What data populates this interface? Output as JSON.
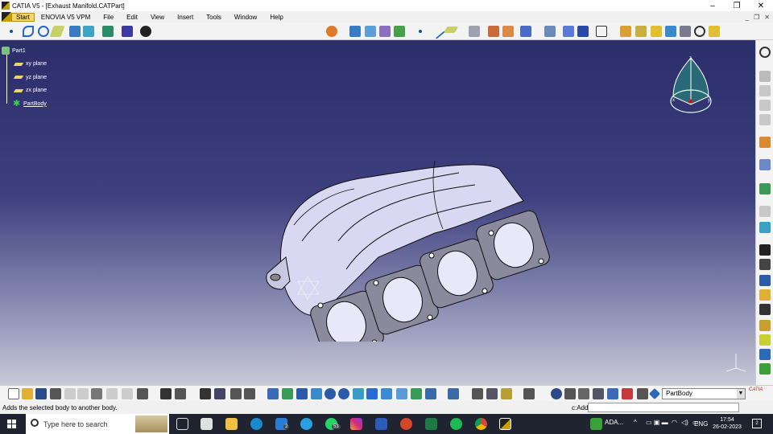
{
  "window": {
    "title": "CATIA V5 - [Exhaust Manifold.CATPart]",
    "controls": [
      "–",
      "❐",
      "✕"
    ]
  },
  "menubar": {
    "items": [
      "Start",
      "ENOVIA V5 VPM",
      "File",
      "Edit",
      "View",
      "Insert",
      "Tools",
      "Window",
      "Help"
    ],
    "inner_controls": [
      "_",
      "❐",
      "✕"
    ]
  },
  "spec_tree": {
    "root": "Part1",
    "planes": [
      "xy plane",
      "yz plane",
      "zx plane"
    ],
    "body": "PartBody"
  },
  "workbench": {
    "current_body_combo": "PartBody",
    "workbench_label": "CATIA"
  },
  "status_bar": {
    "message": "Adds the selected body to another body.",
    "command_label": "c:Add",
    "command_value": ""
  },
  "taskbar": {
    "search_placeholder": "Type here to search",
    "mail_badge": "2",
    "whatsapp_badge": "53",
    "user_label": "ADA...",
    "language": "ENG",
    "time": "17:54",
    "date": "26-02-2023",
    "notifications": "2"
  },
  "compass_axes": [
    "x",
    "y",
    "z"
  ],
  "colors": {
    "viewport_top": "#2c2e6b",
    "viewport_bottom": "#c9c9d8",
    "part_fill": "#d8d8f2",
    "flange_fill": "#8a8a9c",
    "taskbar_bg": "#1f2430"
  }
}
